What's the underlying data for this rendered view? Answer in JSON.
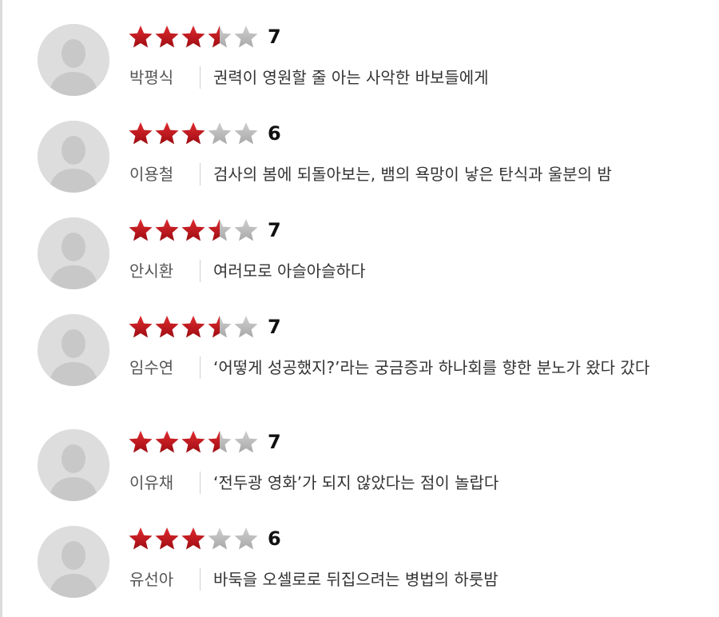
{
  "reviews": [
    {
      "name": "박평식",
      "score": "7",
      "rating": 3.5,
      "comment": "권력이 영원할 줄 아는 사악한 바보들에게"
    },
    {
      "name": "이용철",
      "score": "6",
      "rating": 3,
      "comment": "검사의 봄에 되돌아보는, 뱀의 욕망이 낳은 탄식과 울분의 밤"
    },
    {
      "name": "안시환",
      "score": "7",
      "rating": 3.5,
      "comment": "여러모로 아슬아슬하다"
    },
    {
      "name": "임수연",
      "score": "7",
      "rating": 3.5,
      "comment": "‘어떻게 성공했지?’라는 궁금증과 하나회를 향한 분노가 왔다 갔다"
    },
    {
      "name": "이유채",
      "score": "7",
      "rating": 3.5,
      "comment": "‘전두광 영화’가 되지 않았다는 점이 놀랍다"
    },
    {
      "name": "유선아",
      "score": "6",
      "rating": 3,
      "comment": "바둑을 오셀로로 뒤집으려는 병법의 하룻밤"
    }
  ],
  "colors": {
    "star_filled": "#c4161c",
    "star_empty": "#b8b8b8",
    "avatar_bg": "#dddddd",
    "avatar_fg": "#c8c8c8"
  }
}
